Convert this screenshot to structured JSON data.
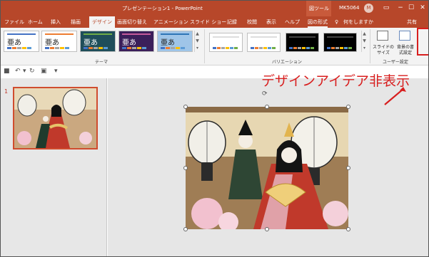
{
  "window": {
    "title": "プレゼンテーション1 - PowerPoint",
    "tools_label": "図ツール",
    "account_name": "MK5064",
    "avatar_initial": "M"
  },
  "tabs": [
    {
      "label": "ファイル"
    },
    {
      "label": "ホーム"
    },
    {
      "label": "挿入"
    },
    {
      "label": "描画"
    },
    {
      "label": "デザイン",
      "active": true
    },
    {
      "label": "画面切り替え"
    },
    {
      "label": "アニメーション"
    },
    {
      "label": "スライド ショー"
    },
    {
      "label": "記録"
    },
    {
      "label": "校閲"
    },
    {
      "label": "表示"
    },
    {
      "label": "ヘルプ"
    },
    {
      "label": "図の形式"
    }
  ],
  "tellme": "何をしますか",
  "share": "共有",
  "ribbon": {
    "themes_group_label": "テーマ",
    "themes": [
      {
        "text": "亜あ",
        "bg": "#ffffff",
        "fg": "#222222",
        "accent": "#4472c4"
      },
      {
        "text": "亜あ",
        "bg": "#ffffff",
        "fg": "#222222",
        "accent": "#ed7d31"
      },
      {
        "text": "亜あ",
        "bg": "#1f4e5a",
        "fg": "#ffffff",
        "accent": "#70ad47"
      },
      {
        "text": "亜あ",
        "bg": "#3b1f5a",
        "fg": "#ffffff",
        "accent": "#c55a9b"
      },
      {
        "text": "亜あ",
        "bg": "#9fc5e8",
        "fg": "#222222",
        "accent": "#2e75b6"
      }
    ],
    "variations_group_label": "バリエーション",
    "variations": [
      {
        "bg": "#ffffff"
      },
      {
        "bg": "#ffffff"
      },
      {
        "bg": "#000000"
      },
      {
        "bg": "#000000"
      }
    ],
    "slide_size_label": "スライドの サイズ",
    "bg_format_label": "背景の書 式設定",
    "user_settings_label": "ユーザー設定"
  },
  "annotation": "デザインアイデア非表示",
  "slides": [
    {
      "number": "1"
    }
  ],
  "colors": {
    "accent": "#b7472a",
    "highlight": "#d81e1e"
  }
}
